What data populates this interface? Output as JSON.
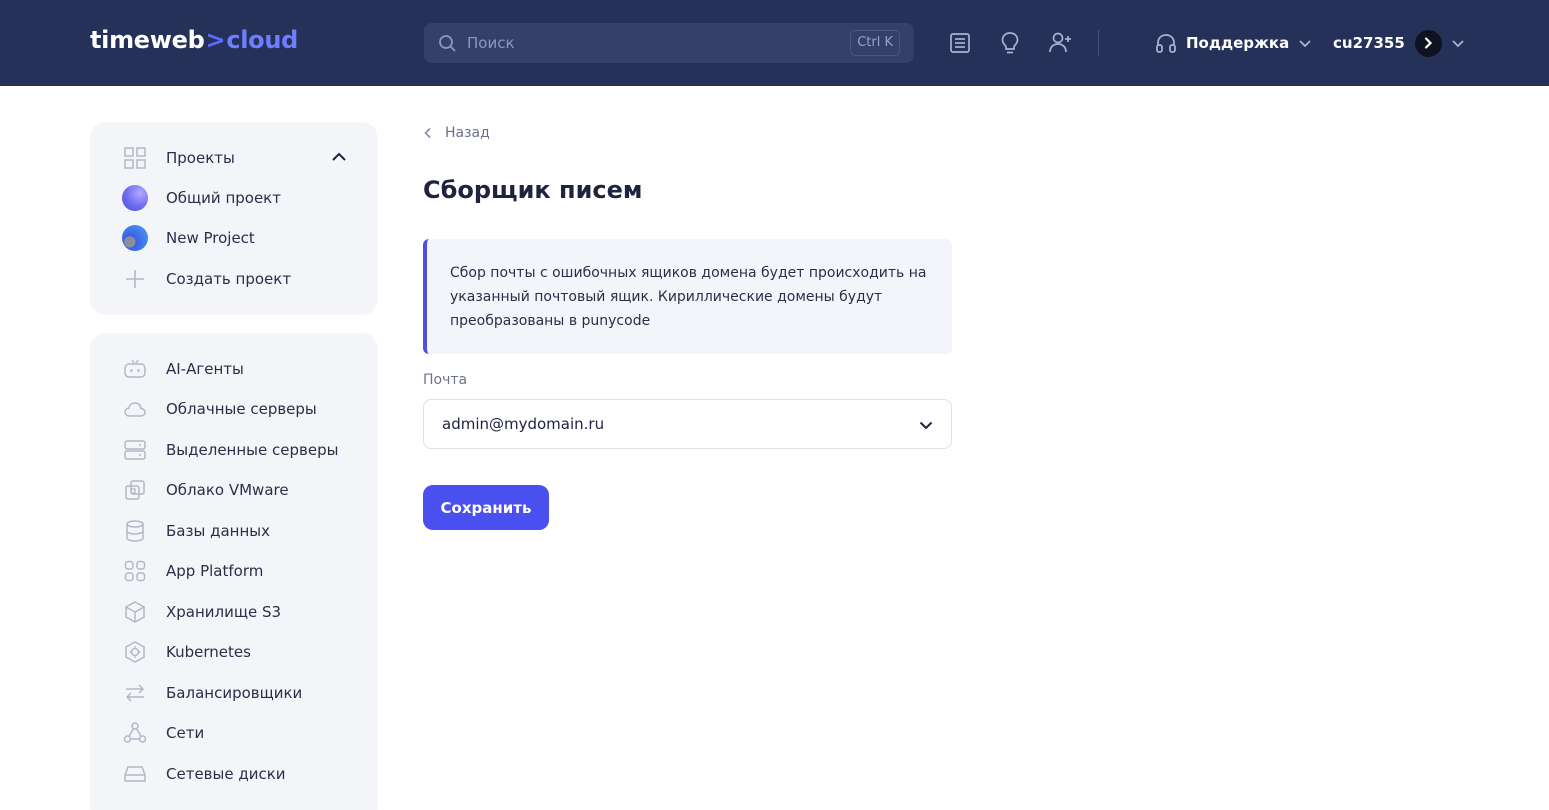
{
  "header": {
    "logo_main": "timeweb",
    "logo_sep": ">",
    "logo_accent": "cloud",
    "search_placeholder": "Поиск",
    "search_shortcut": "Ctrl K",
    "support_label": "Поддержка",
    "user_label": "cu27355",
    "icons": [
      "news-icon",
      "lightbulb-icon",
      "add-user-icon",
      "headphones-icon"
    ]
  },
  "sidebar": {
    "projects_title": "Проекты",
    "projects": [
      {
        "label": "Общий проект",
        "color": "#6b6cf0"
      },
      {
        "label": "New Project",
        "color": "#3c5fe6"
      },
      {
        "label": "Создать проект"
      }
    ],
    "products": [
      {
        "label": "AI-Агенты",
        "icon": "robot-icon"
      },
      {
        "label": "Облачные серверы",
        "icon": "cloud-icon"
      },
      {
        "label": "Выделенные серверы",
        "icon": "server-icon"
      },
      {
        "label": "Облако VMware",
        "icon": "vmware-icon"
      },
      {
        "label": "Базы данных",
        "icon": "database-icon"
      },
      {
        "label": "App Platform",
        "icon": "app-platform-icon"
      },
      {
        "label": "Хранилище S3",
        "icon": "cube-icon"
      },
      {
        "label": "Kubernetes",
        "icon": "kubernetes-icon"
      },
      {
        "label": "Балансировщики",
        "icon": "arrows-icon"
      },
      {
        "label": "Сети",
        "icon": "network-icon"
      },
      {
        "label": "Сетевые диски",
        "icon": "disk-icon"
      }
    ]
  },
  "main": {
    "back_label": "Назад",
    "title": "Сборщик писем",
    "info_text": "Сбор почты с ошибочных ящиков домена будет происходить на указанный почтовый ящик. Кириллические домены будут преобразованы в punycode",
    "field_label": "Почта",
    "field_value": "admin@mydomain.ru",
    "save_label": "Сохранить"
  },
  "colors": {
    "header_bg": "#263159",
    "accent": "#4a4ff0",
    "sidebar_bg": "#f4f5f8"
  }
}
